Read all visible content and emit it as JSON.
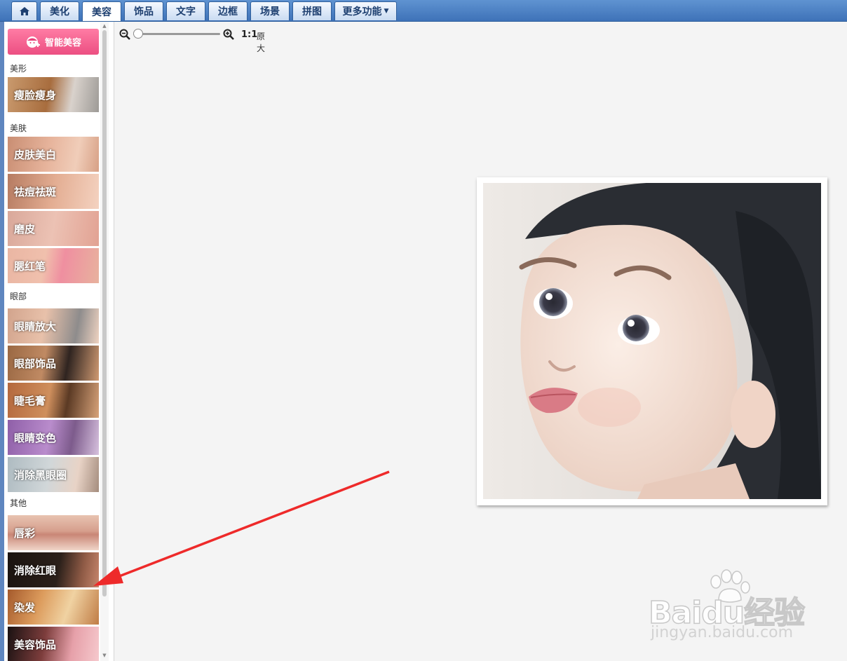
{
  "tabs": [
    {
      "label": "",
      "icon": "home-icon"
    },
    {
      "label": "美化"
    },
    {
      "label": "美容",
      "active": true
    },
    {
      "label": "饰品"
    },
    {
      "label": "文字"
    },
    {
      "label": "边框"
    },
    {
      "label": "场景"
    },
    {
      "label": "拼图"
    },
    {
      "label": "更多功能",
      "dropdown": true
    }
  ],
  "sidebar": {
    "smart_button": "智能美容",
    "sections": [
      {
        "label": "美形",
        "items": [
          "瘦脸瘦身"
        ]
      },
      {
        "label": "美肤",
        "items": [
          "皮肤美白",
          "祛痘祛斑",
          "磨皮",
          "腮红笔"
        ]
      },
      {
        "label": "眼部",
        "items": [
          "眼睛放大",
          "眼部饰品",
          "睫毛膏",
          "眼睛变色",
          "消除黑眼圈"
        ]
      },
      {
        "label": "其他",
        "items": [
          "唇彩",
          "消除红眼",
          "染发",
          "美容饰品"
        ]
      }
    ]
  },
  "zoom": {
    "ratio": "1:1",
    "original_label": "原大"
  },
  "watermark": {
    "brand": "Baidu经验",
    "url": "jingyan.baidu.com"
  },
  "colors": {
    "tabbar": "#4a7fc4",
    "smart_button": "#ee5a8b",
    "arrow": "#ee2a2a"
  }
}
